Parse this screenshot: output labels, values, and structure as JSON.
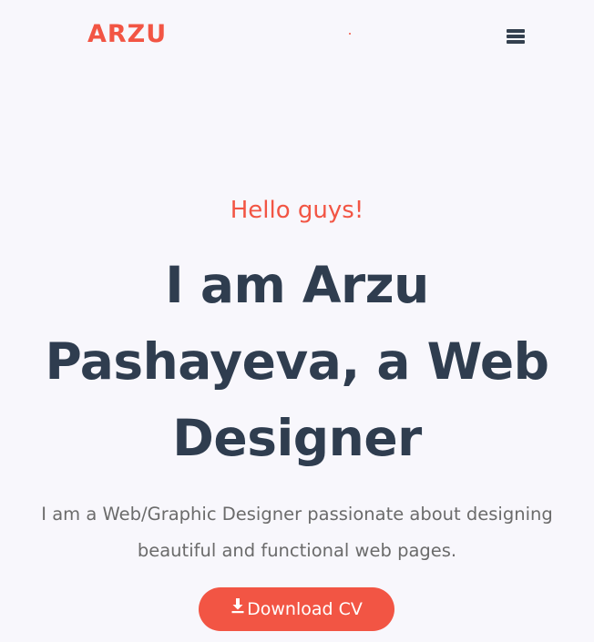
{
  "header": {
    "logo_text": "ARZU",
    "menu_icon": "hamburger-menu-icon"
  },
  "hero": {
    "greeting": "Hello guys!",
    "headline": "I am Arzu Pashayeva, a Web Designer",
    "description": "I am a Web/Graphic Designer passionate about designing beautiful and functional web pages.",
    "cv_button": {
      "label": "Download CV",
      "icon": "download-icon"
    }
  },
  "colors": {
    "accent": "#f25544",
    "heading": "#2f3d4f",
    "body_text": "#6b6b6b",
    "background": "#f8f7fc"
  }
}
